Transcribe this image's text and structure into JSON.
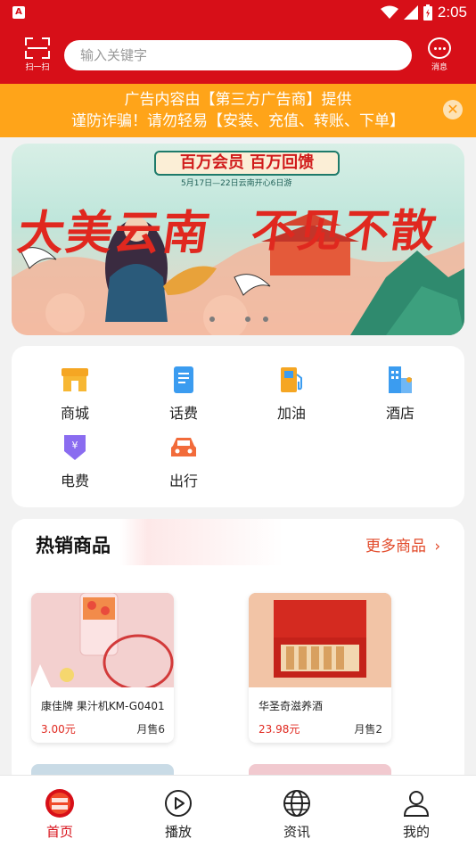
{
  "status_bar": {
    "time": "2:05"
  },
  "header": {
    "scan_label": "扫一扫",
    "search_placeholder": "输入关键字",
    "message_label": "消息"
  },
  "notice": {
    "line1": "广告内容由【第三方广告商】提供",
    "line2": "谨防诈骗！请勿轻易【安装、充值、转账、下单】",
    "close_icon": "close-icon"
  },
  "banner": {
    "headline": "百万会员 百万回馈",
    "subline": "5月17日—22日云南开心6日游",
    "big_left": "大美云南",
    "big_right": "不见不散",
    "slide_count": 3
  },
  "services": [
    {
      "label": "商城",
      "icon": "shop-icon",
      "color": "#f5a623"
    },
    {
      "label": "话费",
      "icon": "phone-bill-icon",
      "color": "#3b9cf0"
    },
    {
      "label": "加油",
      "icon": "fuel-icon",
      "color": "#f5a623"
    },
    {
      "label": "酒店",
      "icon": "hotel-icon",
      "color": "#3b9cf0"
    },
    {
      "label": "电费",
      "icon": "electricity-icon",
      "color": "#8a6cf0"
    },
    {
      "label": "出行",
      "icon": "car-icon",
      "color": "#f26b3a"
    }
  ],
  "hot_products": {
    "title": "热销商品",
    "more_label": "更多商品",
    "items": [
      {
        "name": "康佳牌 果汁机KM-G0401",
        "price": "3.00元",
        "sold": "月售6"
      },
      {
        "name": "华圣奇滋养酒",
        "price": "23.98元",
        "sold": "月售2"
      }
    ]
  },
  "tabs": [
    {
      "label": "首页",
      "icon": "home-logo-icon",
      "active": true
    },
    {
      "label": "播放",
      "icon": "play-icon",
      "active": false
    },
    {
      "label": "资讯",
      "icon": "globe-icon",
      "active": false
    },
    {
      "label": "我的",
      "icon": "profile-icon",
      "active": false
    }
  ],
  "colors": {
    "brand_red": "#d70f18",
    "notice_orange": "#ffa419",
    "price_red": "#e0281f"
  }
}
